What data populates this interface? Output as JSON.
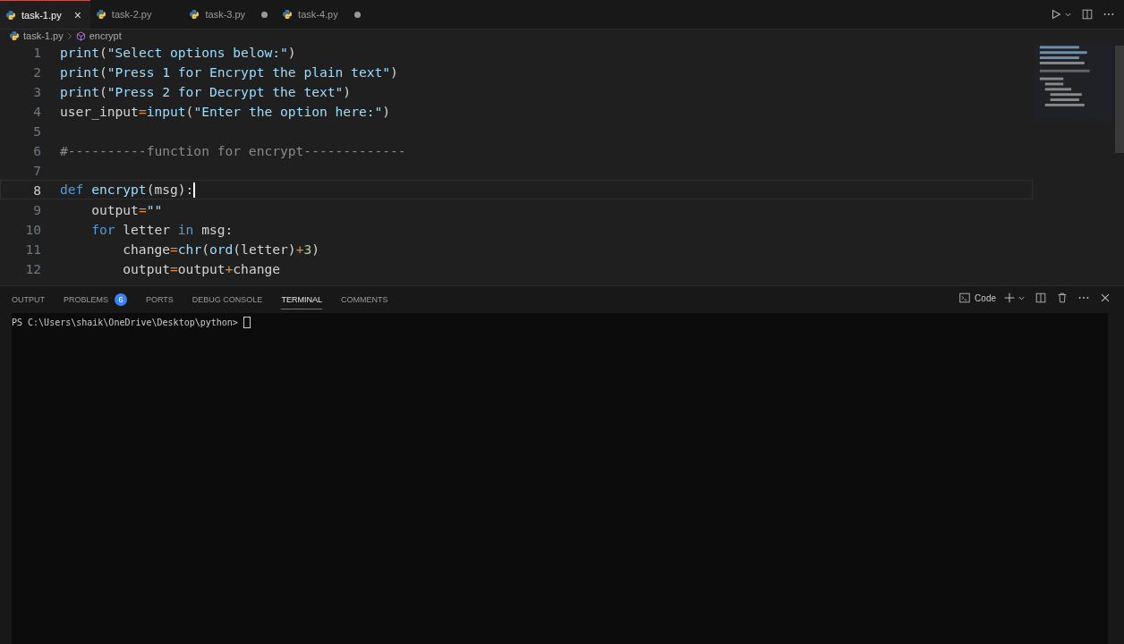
{
  "tabs": [
    {
      "label": "task-1.py",
      "selected": true,
      "modified": false,
      "close": "×"
    },
    {
      "label": "task-2.py",
      "selected": false,
      "modified": false
    },
    {
      "label": "task-3.py",
      "selected": false,
      "modified": true
    },
    {
      "label": "task-4.py",
      "selected": false,
      "modified": true
    }
  ],
  "breadcrumb": {
    "file": "task-1.py",
    "symbol": "encrypt"
  },
  "editor": {
    "lines": [
      {
        "number": "1",
        "tokens": [
          {
            "kind": "call",
            "text": "print"
          },
          {
            "kind": "plain",
            "text": "("
          },
          {
            "kind": "str",
            "text": "\"Select options below:\""
          },
          {
            "kind": "plain",
            "text": ")"
          }
        ]
      },
      {
        "number": "2",
        "tokens": [
          {
            "kind": "call",
            "text": "print"
          },
          {
            "kind": "plain",
            "text": "("
          },
          {
            "kind": "str",
            "text": "\"Press 1 for Encrypt the plain text\""
          },
          {
            "kind": "plain",
            "text": ")"
          }
        ]
      },
      {
        "number": "3",
        "tokens": [
          {
            "kind": "call",
            "text": "print"
          },
          {
            "kind": "plain",
            "text": "("
          },
          {
            "kind": "str",
            "text": "\"Press 2 for Decrypt the text\""
          },
          {
            "kind": "plain",
            "text": ")"
          }
        ]
      },
      {
        "number": "4",
        "tokens": [
          {
            "kind": "plain",
            "text": "user_input"
          },
          {
            "kind": "op",
            "text": "="
          },
          {
            "kind": "call",
            "text": "input"
          },
          {
            "kind": "plain",
            "text": "("
          },
          {
            "kind": "str",
            "text": "\"Enter the option here:\""
          },
          {
            "kind": "plain",
            "text": ")"
          }
        ]
      },
      {
        "number": "5"
      },
      {
        "number": "6",
        "tokens": [
          {
            "kind": "comment",
            "text": "#----------function for encrypt-------------"
          }
        ]
      },
      {
        "number": "7"
      },
      {
        "number": "8",
        "current": true,
        "tokens": [
          {
            "kind": "kw",
            "text": "def"
          },
          {
            "kind": "call",
            "text": " encrypt"
          },
          {
            "kind": "plain",
            "text": "(msg):"
          }
        ]
      },
      {
        "number": "9",
        "tokens": [
          {
            "kind": "plain",
            "text": "    output"
          },
          {
            "kind": "op",
            "text": "="
          },
          {
            "kind": "str",
            "text": "\"\""
          }
        ]
      },
      {
        "number": "10",
        "tokens": [
          {
            "kind": "kw",
            "text": "    for"
          },
          {
            "kind": "plain",
            "text": " letter "
          },
          {
            "kind": "kw",
            "text": "in"
          },
          {
            "kind": "plain",
            "text": " msg:"
          }
        ]
      },
      {
        "number": "11",
        "tokens": [
          {
            "kind": "plain",
            "text": "        change"
          },
          {
            "kind": "op",
            "text": "="
          },
          {
            "kind": "call",
            "text": "chr"
          },
          {
            "kind": "plain",
            "text": "("
          },
          {
            "kind": "call",
            "text": "ord"
          },
          {
            "kind": "plain",
            "text": "(letter)"
          },
          {
            "kind": "op",
            "text": "+"
          },
          {
            "kind": "num",
            "text": "3"
          },
          {
            "kind": "plain",
            "text": ")"
          }
        ]
      },
      {
        "number": "12",
        "tokens": [
          {
            "kind": "plain",
            "text": "        output"
          },
          {
            "kind": "op",
            "text": "="
          },
          {
            "kind": "plain",
            "text": "output"
          },
          {
            "kind": "op",
            "text": "+"
          },
          {
            "kind": "plain",
            "text": "change"
          }
        ]
      }
    ]
  },
  "panel_tabs": [
    {
      "label": "OUTPUT",
      "selected": false
    },
    {
      "label": "PROBLEMS",
      "selected": false,
      "badge": "6"
    },
    {
      "label": "PORTS",
      "selected": false
    },
    {
      "label": "DEBUG CONSOLE",
      "selected": false
    },
    {
      "label": "TERMINAL",
      "selected": true
    },
    {
      "label": "COMMENTS",
      "selected": false
    }
  ],
  "terminal": {
    "shell": "Code",
    "prompt": "PS C:\\Users\\shaik\\OneDrive\\Desktop\\python> "
  }
}
